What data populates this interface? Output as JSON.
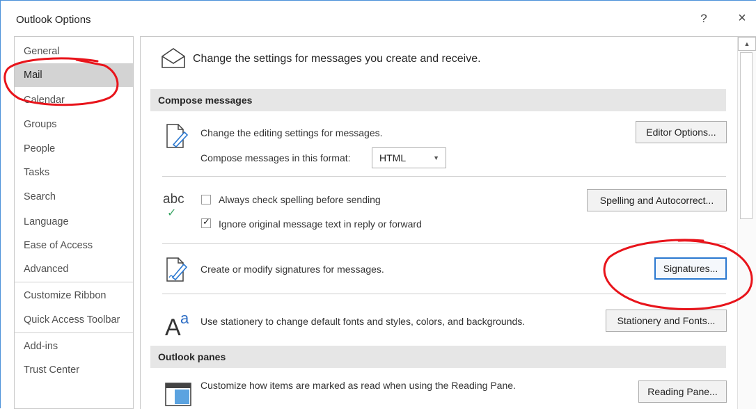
{
  "window": {
    "title": "Outlook Options",
    "help": "?",
    "close": "×"
  },
  "nav": {
    "items": [
      {
        "label": "General"
      },
      {
        "label": "Mail",
        "selected": true
      },
      {
        "label": "Calendar"
      },
      {
        "label": "Groups"
      },
      {
        "label": "People"
      },
      {
        "label": "Tasks"
      },
      {
        "label": "Search"
      },
      {
        "label": "Language"
      },
      {
        "label": "Ease of Access"
      },
      {
        "label": "Advanced"
      },
      {
        "label": "Customize Ribbon"
      },
      {
        "label": "Quick Access Toolbar"
      },
      {
        "label": "Add-ins"
      },
      {
        "label": "Trust Center"
      }
    ]
  },
  "header": {
    "text": "Change the settings for messages you create and receive."
  },
  "compose": {
    "section_title": "Compose messages",
    "editing_text": "Change the editing settings for messages.",
    "editor_options_button": "Editor Options...",
    "format_label": "Compose messages in this format:",
    "format_value": "HTML",
    "abc_label": "abc",
    "spelling_check_label": "Always check spelling before sending",
    "spelling_check_checked": false,
    "ignore_original_label": "Ignore original message text in reply or forward",
    "ignore_original_checked": true,
    "spelling_button": "Spelling and Autocorrect...",
    "signatures_text": "Create or modify signatures for messages.",
    "signatures_button": "Signatures...",
    "stationery_text": "Use stationery to change default fonts and styles, colors, and backgrounds.",
    "stationery_button": "Stationery and Fonts..."
  },
  "panes": {
    "section_title": "Outlook panes",
    "reading_text": "Customize how items are marked as read when using the Reading Pane.",
    "reading_button": "Reading Pane..."
  },
  "colors": {
    "annotation": "#e8141b",
    "accent": "#2b78d0",
    "selected_nav": "#d3d3d3",
    "section_bar": "#e6e6e6"
  }
}
